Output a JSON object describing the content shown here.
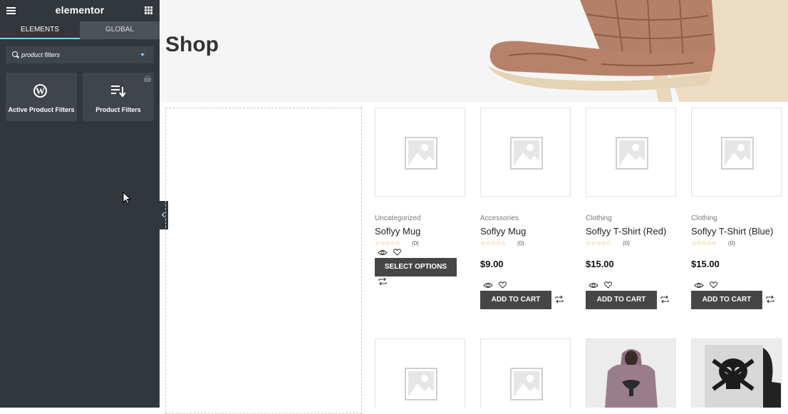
{
  "editor": {
    "logo": "elementor",
    "tabs": [
      {
        "label": "ELEMENTS"
      },
      {
        "label": "GLOBAL"
      }
    ],
    "search": {
      "value": "product filters"
    },
    "widgets": [
      {
        "label": "Active Product Filters",
        "icon": "wordpress-icon"
      },
      {
        "label": "Product Filters",
        "icon": "filter-list-icon"
      }
    ]
  },
  "page": {
    "title": "Shop"
  },
  "products": [
    {
      "category": "Uncategorized",
      "name": "Soflyy Mug",
      "rating_count": "(0)",
      "price": "",
      "button": "SELECT OPTIONS"
    },
    {
      "category": "Accessories",
      "name": "Soflyy Mug",
      "rating_count": "(0)",
      "price": "$9.00",
      "button": "ADD TO CART"
    },
    {
      "category": "Clothing",
      "name": "Soflyy T-Shirt (Red)",
      "rating_count": "(0)",
      "price": "$15.00",
      "button": "ADD TO CART"
    },
    {
      "category": "Clothing",
      "name": "Soflyy T-Shirt (Blue)",
      "rating_count": "(0)",
      "price": "$15.00",
      "button": "ADD TO CART"
    }
  ],
  "star_glyphs": "☆☆☆☆☆",
  "colors": {
    "panel": "#32373c",
    "accent": "#71d7f7",
    "button": "#464646",
    "star": "#e0a95a"
  }
}
